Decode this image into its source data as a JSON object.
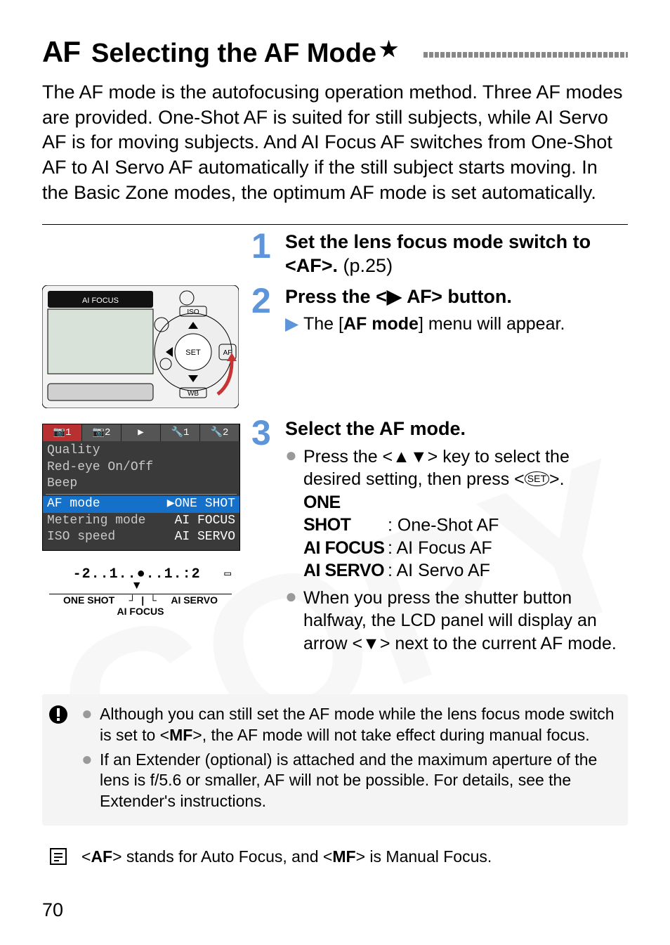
{
  "heading": {
    "prefix": "AF",
    "title": "Selecting the AF Mode",
    "star": "★"
  },
  "intro": "The AF mode is the autofocusing operation method. Three AF modes are provided. One-Shot AF is suited for still subjects, while AI Servo AF is for moving subjects. And AI Focus AF switches from One-Shot AF to AI Servo AF automatically if the still subject starts moving. In the Basic Zone modes, the optimum AF mode is set automatically.",
  "steps": [
    {
      "num": "1",
      "headline_prefix": "Set the lens focus mode switch to <AF>.",
      "headline_suffix": " (p.25)"
    },
    {
      "num": "2",
      "headline_html_parts": {
        "a": "Press the <",
        "b": "> button.",
        "af_glyph": "AF"
      },
      "bullets": [
        "The [AF mode] menu will appear."
      ],
      "bullet_bold": "AF mode"
    },
    {
      "num": "3",
      "headline": "Select the AF mode.",
      "desc_prefix": "Press the <",
      "desc_mid": "> key to select the desired setting, then press <",
      "desc_suffix": ">.",
      "modes": [
        {
          "glyph": "ONE SHOT",
          "label": ": One-Shot AF"
        },
        {
          "glyph": "AI FOCUS",
          "label": ": AI Focus AF"
        },
        {
          "glyph": "AI SERVO",
          "label": ": AI Servo AF"
        }
      ],
      "extra_prefix": "When you press the shutter button halfway, the LCD panel will display an arrow <",
      "extra_suffix": "> next to the current AF mode."
    }
  ],
  "camera_top_labels": {
    "top_strip": "AI FOCUS",
    "top_strip_left": "ONE SHOT",
    "top_strip_right": "AI SERVO",
    "iso": "ISO",
    "wb": "WB",
    "af": "AF",
    "set": "SET"
  },
  "menu": {
    "tabs": [
      "📷1",
      "📷2",
      "▶",
      "🔧1",
      "🔧2"
    ],
    "rows_top": [
      "Quality",
      "Red-eye On/Off",
      "Beep"
    ],
    "af_row_label": "AF mode",
    "af_row_value": "▶ONE SHOT",
    "rows_bottom": [
      {
        "l": "Metering mode",
        "r": "AI FOCUS"
      },
      {
        "l": "ISO speed",
        "r": "AI SERVO"
      }
    ]
  },
  "lcd": {
    "ticks": "-2..1..●..1.:2",
    "battery": "▭",
    "left": "ONE SHOT",
    "right": "AI SERVO",
    "center": "AI FOCUS",
    "pointer": "▼"
  },
  "warning_notes": [
    "Although you can still set the AF mode while the lens focus mode switch is set to <MF>, the AF mode will not take effect during manual focus.",
    "If an Extender (optional) is attached and the maximum aperture of the lens is f/5.6 or smaller, AF will not be possible. For details, see the Extender's instructions."
  ],
  "warning_bold": "MF",
  "info_note": "<AF> stands for Auto Focus, and <MF> is Manual Focus.",
  "info_bold1": "AF",
  "info_bold2": "MF",
  "page_number": "70"
}
